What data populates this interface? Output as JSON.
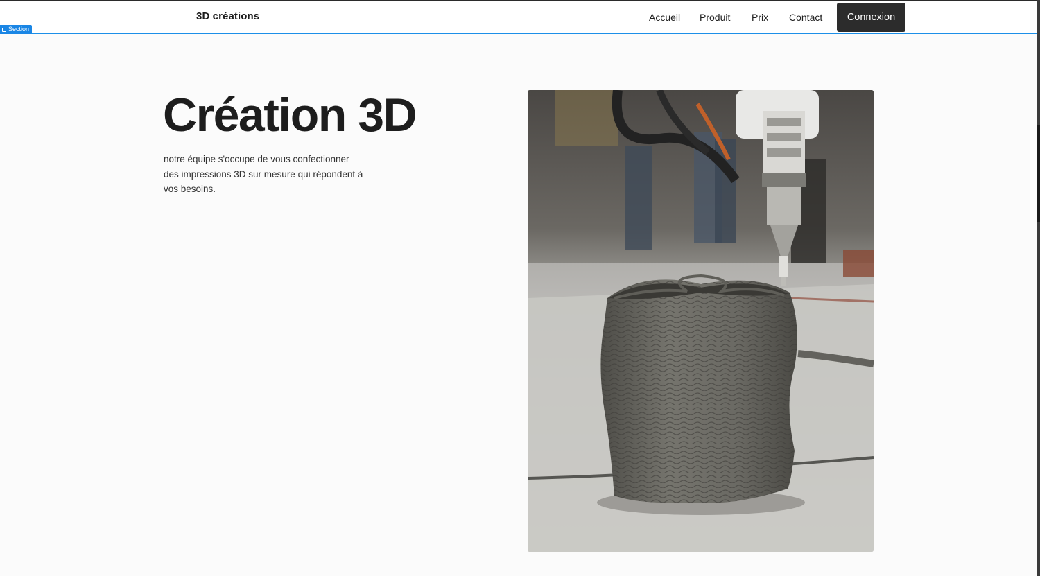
{
  "header": {
    "brand": "3D créations",
    "nav": [
      "Accueil",
      "Produit",
      "Prix",
      "Contact"
    ],
    "login_label": "Connexion"
  },
  "editor": {
    "section_tag": "Section"
  },
  "hero": {
    "title": "Création 3D",
    "text": "notre équipe s'occupe de vous confectionner des impressions 3D sur mesure qui répondent à vos besoins."
  },
  "colors": {
    "header_bg": "#ffffff",
    "page_bg": "#fbfbfb",
    "button_bg": "#2c2c2c",
    "section_accent": "#1a86e5"
  }
}
